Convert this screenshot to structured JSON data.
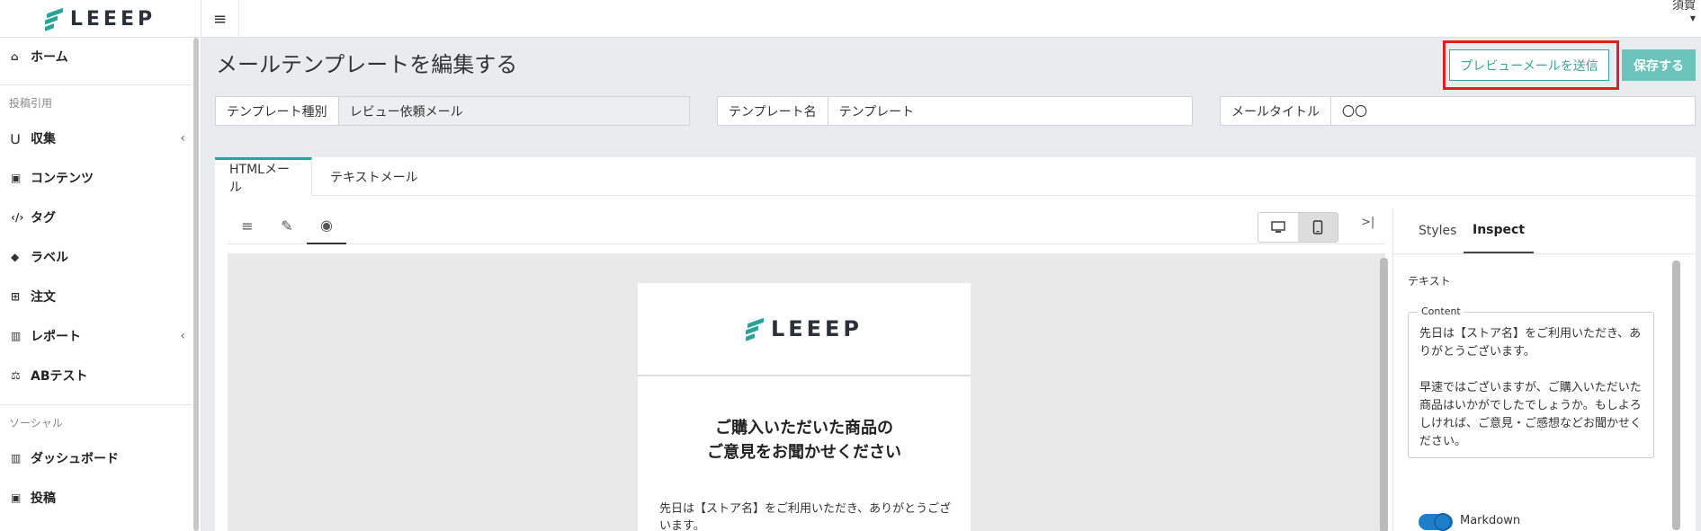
{
  "brand": {
    "name": "LEEEP",
    "accent": "#2aa39a"
  },
  "header": {
    "menu_icon": "≡",
    "user_name": "須賀"
  },
  "sidebar": {
    "items": [
      {
        "label": "ホーム",
        "icon": "home-icon"
      },
      {
        "label": "収集",
        "icon": "magnet-icon"
      },
      {
        "label": "コンテンツ",
        "icon": "image-icon"
      },
      {
        "label": "タグ",
        "icon": "code-icon"
      },
      {
        "label": "ラベル",
        "icon": "tag-icon"
      },
      {
        "label": "注文",
        "icon": "cart-icon"
      },
      {
        "label": "レポート",
        "icon": "chart-icon"
      },
      {
        "label": "ABテスト",
        "icon": "scale-icon"
      },
      {
        "label": "ダッシュボード",
        "icon": "chart-icon"
      },
      {
        "label": "投稿",
        "icon": "image-icon"
      }
    ],
    "sections": {
      "posts": "投稿引用",
      "social": "ソーシャル"
    }
  },
  "page": {
    "title": "メールテンプレートを編集する",
    "preview_button": "プレビューメールを送信",
    "save_button": "保存する"
  },
  "fields": {
    "template_type": {
      "label": "テンプレート種別",
      "value": "レビュー依頼メール"
    },
    "template_name": {
      "label": "テンプレート名",
      "value": "テンプレート"
    },
    "mail_title": {
      "label": "メールタイトル",
      "value": "〇〇"
    }
  },
  "editor": {
    "tabs": [
      "HTMLメール",
      "テキストメール"
    ],
    "panel_tabs": [
      "Styles",
      "Inspect"
    ],
    "inspect": {
      "section_label": "テキスト",
      "content_legend": "Content",
      "content_text": "先日は【ストア名】をご利用いただき、ありがとうございます。\n\n早速ではございますが、ご購入いただいた商品はいかがでしたでしょうか。もしよろしければ、ご意見・ご感想などお聞かせください。",
      "markdown_label": "Markdown"
    }
  },
  "email_preview": {
    "logo": "LEEEP",
    "title_line1": "ご購入いただいた商品の",
    "title_line2": "ご意見をお聞かせください",
    "body": "先日は【ストア名】をご利用いただき、ありがとうございます。"
  }
}
